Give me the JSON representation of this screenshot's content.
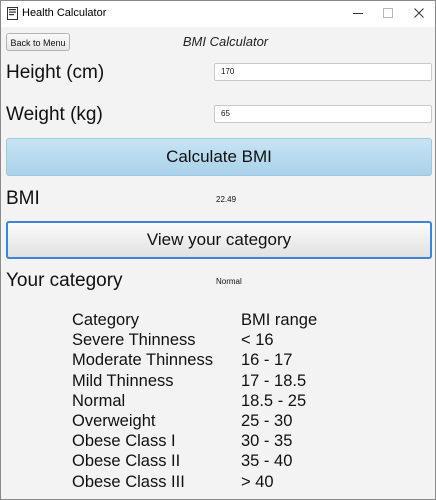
{
  "window": {
    "title": "Health Calculator",
    "icon": "app-document-icon",
    "controls": {
      "minimize": "minimize-icon",
      "maximize": "maximize-icon",
      "close": "close-icon"
    }
  },
  "header": {
    "back_label": "Back to Menu",
    "title": "BMI Calculator"
  },
  "form": {
    "height_label": "Height (cm)",
    "height_value": "170",
    "weight_label": "Weight (kg)",
    "weight_value": "65",
    "calculate_label": "Calculate BMI"
  },
  "result": {
    "bmi_label": "BMI",
    "bmi_value": "22.49",
    "view_label": "View your category",
    "category_label": "Your category",
    "category_value": "Normal"
  },
  "table": {
    "header": [
      "Category",
      "BMI range"
    ],
    "rows": [
      [
        "Severe Thinness",
        "< 16"
      ],
      [
        "Moderate Thinness",
        "16 - 17"
      ],
      [
        "Mild Thinness",
        "17 - 18.5"
      ],
      [
        "Normal",
        "18.5 - 25"
      ],
      [
        "Overweight",
        "25 - 30"
      ],
      [
        "Obese Class I",
        "30 - 35"
      ],
      [
        "Obese Class II",
        "35 - 40"
      ],
      [
        "Obese Class III",
        "> 40"
      ]
    ]
  },
  "colors": {
    "calculate_button": "#b3d9ee",
    "focus_border": "#3c84d8",
    "background": "#f3f3f3"
  }
}
